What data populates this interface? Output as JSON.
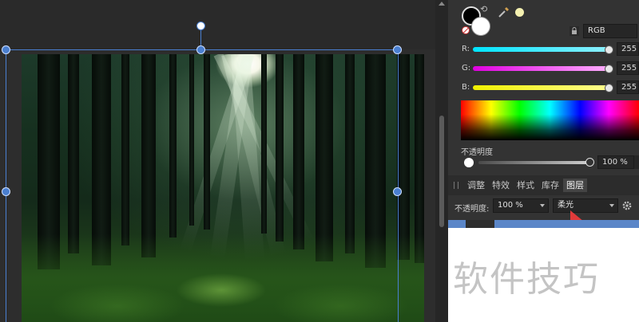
{
  "color_panel": {
    "color_model": "RGB",
    "channels": [
      {
        "label": "R:",
        "value": "255"
      },
      {
        "label": "G:",
        "value": "255"
      },
      {
        "label": "B:",
        "value": "255"
      }
    ],
    "opacity_label": "不透明度",
    "opacity_value": "100 %"
  },
  "studio_tabs": [
    "调整",
    "特效",
    "样式",
    "库存",
    "图层"
  ],
  "active_tab": "图层",
  "layers_panel": {
    "opacity_label": "不透明度:",
    "opacity_value": "100 %",
    "blend_mode": "柔光"
  },
  "watermark": "软件技巧",
  "icons": [
    "swap-colors-icon",
    "eyedropper-icon",
    "lock-icon",
    "gear-icon",
    "no-fill-icon"
  ],
  "colors": {
    "selection": "#4a7fd0",
    "panel_bg": "#333333",
    "layer_highlight": "#5b86c8",
    "annotation_arrow": "#e03a3a"
  }
}
